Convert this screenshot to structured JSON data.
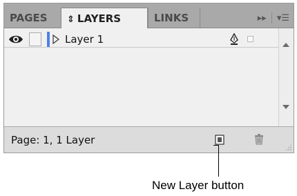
{
  "panel": {
    "tabs": [
      {
        "label": "PAGES",
        "active": false
      },
      {
        "label": "LAYERS",
        "active": true,
        "icon": "up-down-arrows-icon"
      },
      {
        "label": "LINKS",
        "active": false
      }
    ],
    "toolbar_icons": [
      "double-chevron-right-icon",
      "panel-menu-icon"
    ]
  },
  "layers": [
    {
      "name": "Layer 1",
      "visible": true,
      "locked": false,
      "color": "#4f7fe8",
      "expanded": false
    }
  ],
  "footer": {
    "status": "Page: 1, 1 Layer"
  },
  "callout": {
    "label": "New Layer button"
  },
  "colors": {
    "panel_bg": "#d6d6d6",
    "tab_strip": "#a9a9a9",
    "active_tab": "#f0f0f0",
    "layer_color": "#4f7fe8"
  }
}
